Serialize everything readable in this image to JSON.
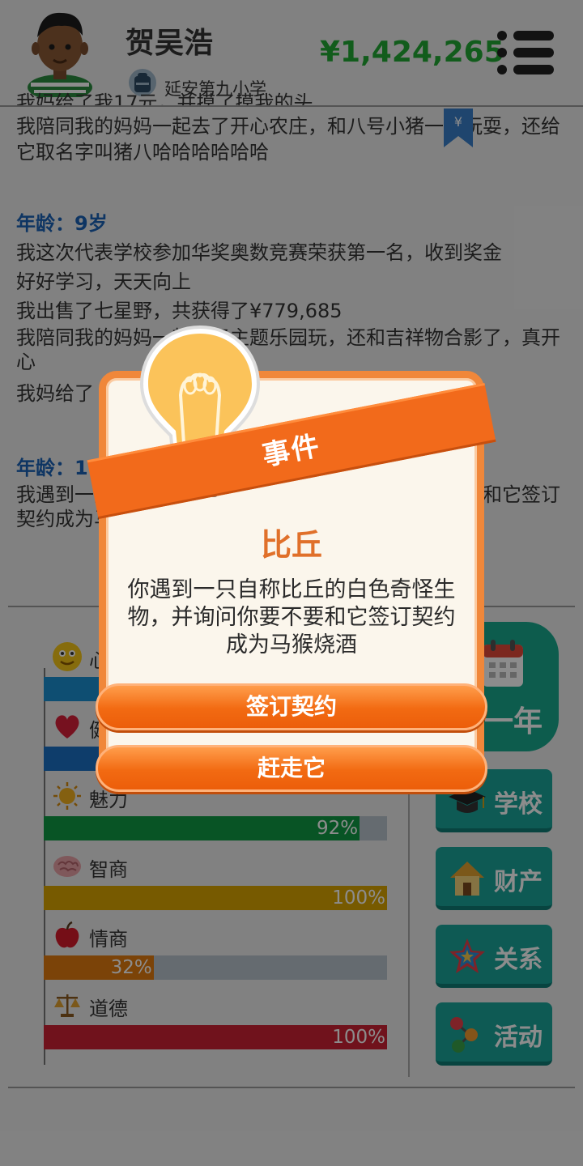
{
  "header": {
    "name": "贺吴浩",
    "school": "延安第九小学",
    "money": "¥1,424,265"
  },
  "log": {
    "lines_top": [
      "我妈给了我17元，并摸了摸我的头",
      "我陪同我的妈妈一起去了开心农庄，和八号小猪一起玩耍，还给它取名字叫猪八哈哈哈哈哈哈"
    ],
    "age9_label": "年龄：9岁",
    "age9_lines": [
      "我这次代表学校参加华奖奥数竞赛荣获第一名，收到奖金",
      "好好学习，天天向上",
      "我出售了七星野，共获得了¥779,685",
      "我陪同我的妈妈一起去了主题乐园玩，还和吉祥物合影了，真开心",
      "我妈给了"
    ],
    "age10_label": "年龄：1",
    "age10_lines": [
      "我遇到一只自称比丘的白色奇怪生物，并询问你要不要和它签订契约成为马猴烧酒"
    ]
  },
  "stats": [
    {
      "label": "心情",
      "percent": 100,
      "pct_text": "",
      "color": "#1a8fd0",
      "icon": "smiley-icon"
    },
    {
      "label": "健康",
      "percent": 100,
      "pct_text": "",
      "color": "#1a6fc4",
      "icon": "heart-icon"
    },
    {
      "label": "魅力",
      "percent": 92,
      "pct_text": "92%",
      "color": "#109a44",
      "icon": "sun-icon"
    },
    {
      "label": "智商",
      "percent": 100,
      "pct_text": "100%",
      "color": "#d9a500",
      "icon": "brain-icon"
    },
    {
      "label": "情商",
      "percent": 32,
      "pct_text": "32%",
      "color": "#e07a10",
      "icon": "apple-icon"
    },
    {
      "label": "道德",
      "percent": 100,
      "pct_text": "100%",
      "color": "#cc2233",
      "icon": "scale-icon"
    }
  ],
  "side": {
    "next_year": "一年",
    "school": "学校",
    "assets": "财产",
    "relations": "关系",
    "activities": "活动"
  },
  "event": {
    "ribbon": "事件",
    "title": "比丘",
    "description": "你遇到一只自称比丘的白色奇怪生物，并询问你要不要和它签订契约成为马猴烧酒",
    "option1": "签订契约",
    "option2": "赶走它"
  }
}
